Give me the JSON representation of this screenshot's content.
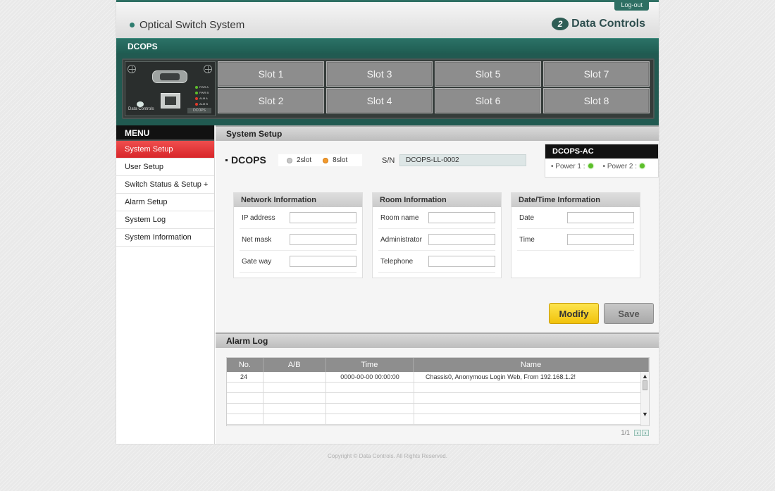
{
  "header": {
    "logout_label": "Log-out",
    "app_title": "Optical Switch System",
    "brand_name": "Data Controls",
    "brand_mark": "2"
  },
  "device": {
    "title": "DCOPS",
    "module_leds": [
      "PWR A",
      "PWR B",
      "ALM A",
      "ALM B"
    ],
    "module_brand": "Data Controls",
    "module_tag": "DCOPS",
    "slots": [
      "Slot 1",
      "Slot 3",
      "Slot 5",
      "Slot 7",
      "Slot 2",
      "Slot 4",
      "Slot 6",
      "Slot 8"
    ]
  },
  "menu": {
    "title": "MENU",
    "items": [
      {
        "label": "System Setup",
        "active": true
      },
      {
        "label": "User Setup"
      },
      {
        "label": "Switch Status & Setup +"
      },
      {
        "label": "Alarm Setup"
      },
      {
        "label": "System Log"
      },
      {
        "label": "System Information"
      }
    ]
  },
  "system_setup": {
    "section_title": "System Setup",
    "device_name": "DCOPS",
    "slot_options": [
      "2slot",
      "8slot"
    ],
    "sn_label": "S/N",
    "sn_value": "DCOPS-LL-0002",
    "power": {
      "title": "DCOPS-AC",
      "power1_label": "Power 1 :",
      "power2_label": "Power 2 :",
      "status_color": "#5cbf2a"
    },
    "network": {
      "title": "Network Information",
      "fields": [
        "IP address",
        "Net mask",
        "Gate way"
      ]
    },
    "room": {
      "title": "Room Information",
      "fields": [
        "Room name",
        "Administrator",
        "Telephone"
      ]
    },
    "datetime": {
      "title": "Date/Time Information",
      "fields": [
        "Date",
        "Time"
      ]
    },
    "modify_label": "Modify",
    "save_label": "Save"
  },
  "alarm_log": {
    "section_title": "Alarm Log",
    "columns": [
      "No.",
      "A/B",
      "Time",
      "Name"
    ],
    "rows": [
      {
        "no": "24",
        "ab": "",
        "time": "0000-00-00  00:00:00",
        "name": "Chassis0, Anonymous Login Web, From 192.168.1.2!"
      }
    ],
    "pager": "1/1"
  },
  "footer": {
    "copyright": "Copyright © Data Controls. All Rights Reserved."
  }
}
